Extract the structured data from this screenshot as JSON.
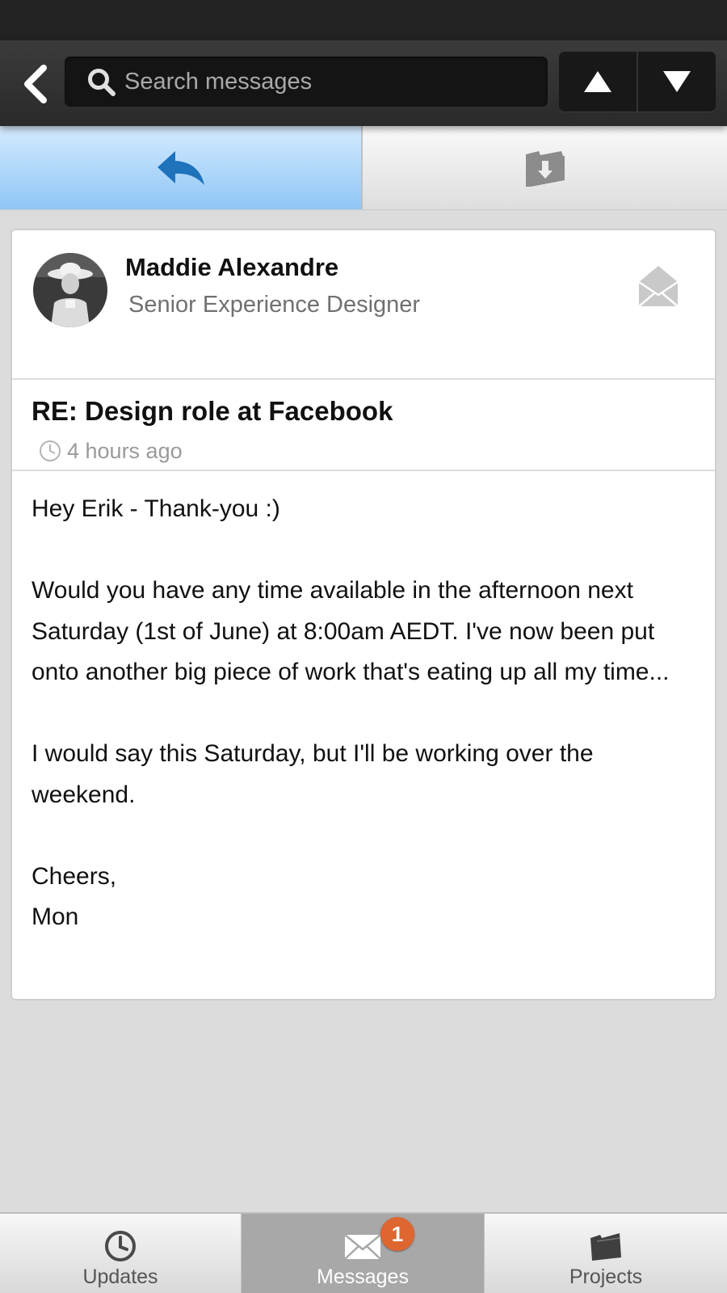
{
  "header": {
    "search_placeholder": "Search messages",
    "icons": {
      "back": "chevron-left-icon",
      "search": "magnifier-icon",
      "previous": "triangle-up-icon",
      "next": "triangle-down-icon"
    }
  },
  "actions": {
    "reply_icon": "reply-arrow-icon",
    "archive_icon": "archive-folder-icon",
    "active_tab": "reply",
    "active_color": "#8fc6f6"
  },
  "message": {
    "sender": {
      "name": "Maddie Alexandre",
      "title": "Senior Experience Designer"
    },
    "status_icon": "envelope-open-icon",
    "subject": "RE: Design role at Facebook",
    "time": "4 hours ago",
    "body": [
      "Hey Erik - Thank-you :)",
      "Would you have any time available in the afternoon next Saturday (1st of June) at 8:00am AEDT. I've now been put onto another big piece of work that's eating up all my time...",
      "I would say this Saturday, but I'll be working over the weekend.",
      "Cheers,",
      "Mon"
    ]
  },
  "tabbar": {
    "tabs": [
      {
        "label": "Updates",
        "icon": "clock-icon"
      },
      {
        "label": "Messages",
        "icon": "envelope-icon",
        "badge": "1"
      },
      {
        "label": "Projects",
        "icon": "folder-icon"
      }
    ],
    "active": "Messages",
    "badge_color": "#de6630"
  }
}
